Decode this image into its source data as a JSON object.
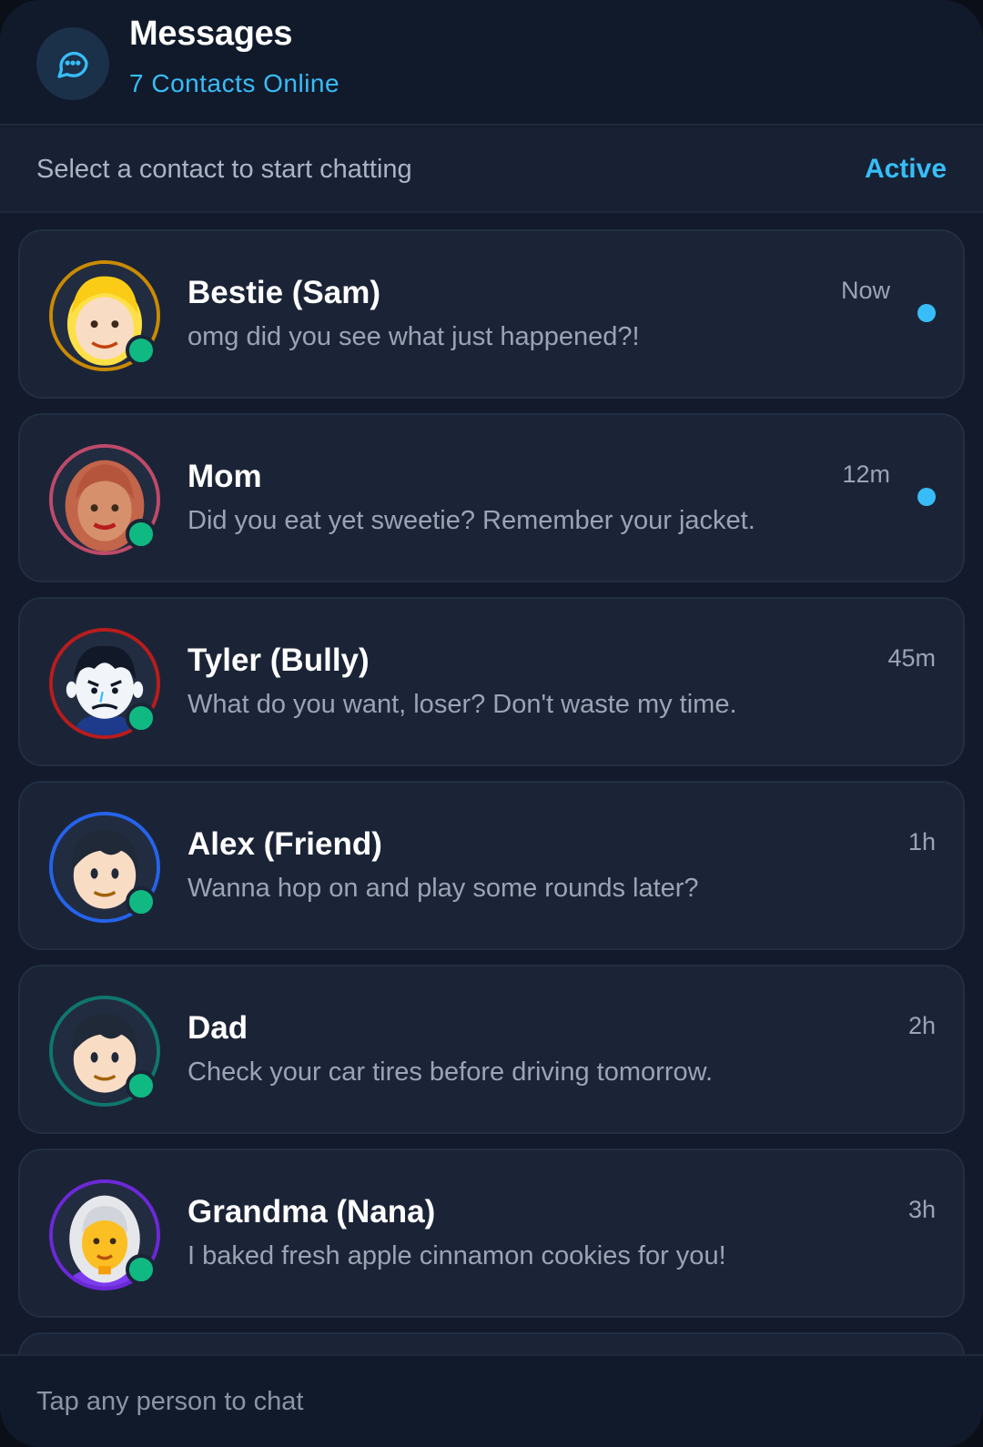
{
  "header": {
    "title": "Messages",
    "subtitle": "7 Contacts Online",
    "icon": "chat-bubble-icon"
  },
  "subbar": {
    "prompt": "Select a contact to start chatting",
    "status": "Active"
  },
  "contacts": [
    {
      "name": "Bestie (Sam)",
      "preview": "omg did you see what just happened?!",
      "time": "Now",
      "unread": true,
      "online": true,
      "ring_color": "#ca8a04",
      "avatar": "blonde-person-avatar"
    },
    {
      "name": "Mom",
      "preview": "Did you eat yet sweetie? Remember your jacket.",
      "time": "12m",
      "unread": true,
      "online": true,
      "ring_color": "#be4a6a",
      "avatar": "woman-red-hair-avatar"
    },
    {
      "name": "Tyler (Bully)",
      "preview": "What do you want, loser? Don't waste my time.",
      "time": "45m",
      "unread": false,
      "online": true,
      "ring_color": "#b91c1c",
      "avatar": "angry-boy-avatar"
    },
    {
      "name": "Alex (Friend)",
      "preview": "Wanna hop on and play some rounds later?",
      "time": "1h",
      "unread": false,
      "online": true,
      "ring_color": "#2563eb",
      "avatar": "boy-dark-hair-avatar"
    },
    {
      "name": "Dad",
      "preview": "Check your car tires before driving tomorrow.",
      "time": "2h",
      "unread": false,
      "online": true,
      "ring_color": "#0f766e",
      "avatar": "man-dark-hair-avatar"
    },
    {
      "name": "Grandma (Nana)",
      "preview": "I baked fresh apple cinnamon cookies for you!",
      "time": "3h",
      "unread": false,
      "online": true,
      "ring_color": "#6d28d9",
      "avatar": "grandma-white-hair-avatar"
    }
  ],
  "footer": {
    "hint": "Tap any person to chat"
  },
  "colors": {
    "accent": "#38bdf8",
    "online": "#10b981",
    "background": "#121a2b",
    "card": "#1b2436"
  }
}
